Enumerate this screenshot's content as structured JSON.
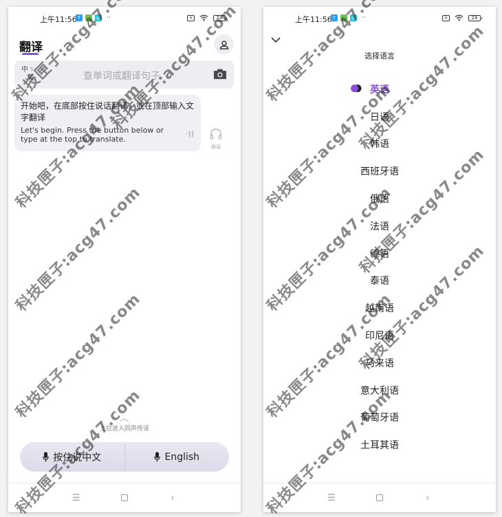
{
  "status_bar": {
    "time": "上午11:56",
    "battery": "24",
    "app_icons": [
      {
        "name": "upload-app-icon",
        "color": "#2d9cf0",
        "glyph": "↑"
      },
      {
        "name": "download-app-icon",
        "color": "#6cc24a",
        "glyph": "↓"
      },
      {
        "name": "sync-app-icon",
        "color": "#27c4d8",
        "glyph": "◎"
      }
    ],
    "more": "··"
  },
  "left_screen": {
    "tab_title": "翻译",
    "search": {
      "lang_from": "中",
      "lang_to": "英",
      "placeholder": "查单词或翻译句子"
    },
    "hint_bubble": {
      "zh": "开始吧，在底部按住说话翻译，或在顶部输入文字翻译",
      "en": "Let's begin. Press the button below or type at the top to translate."
    },
    "listen_label": "跟读",
    "pull_hint": "上拉进入同声传译",
    "voice_buttons": {
      "chinese": "按住说中文",
      "english": "English"
    }
  },
  "right_screen": {
    "title": "选择语言",
    "languages": [
      {
        "label": "英语",
        "selected": true
      },
      {
        "label": "日语",
        "selected": false
      },
      {
        "label": "韩语",
        "selected": false
      },
      {
        "label": "西班牙语",
        "selected": false
      },
      {
        "label": "俄语",
        "selected": false
      },
      {
        "label": "法语",
        "selected": false
      },
      {
        "label": "德语",
        "selected": false
      },
      {
        "label": "泰语",
        "selected": false
      },
      {
        "label": "越南语",
        "selected": false
      },
      {
        "label": "印尼语",
        "selected": false
      },
      {
        "label": "马来语",
        "selected": false
      },
      {
        "label": "意大利语",
        "selected": false
      },
      {
        "label": "葡萄牙语",
        "selected": false
      },
      {
        "label": "土耳其语",
        "selected": false
      }
    ]
  },
  "nav": {
    "menu": "☰",
    "back": "‹"
  },
  "colors": {
    "accent": "#8a4fd8"
  },
  "watermark": "科技匣子:acg47.com"
}
